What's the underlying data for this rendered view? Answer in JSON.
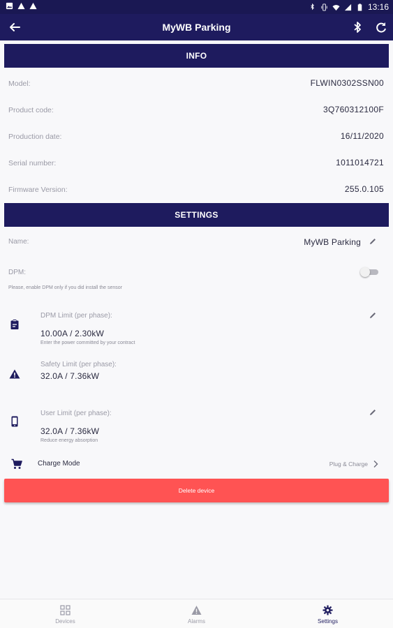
{
  "status_bar": {
    "time": "13:16",
    "left_icons": [
      "image-icon",
      "warning-icon",
      "warning-icon"
    ],
    "right_icons": [
      "bluetooth-icon",
      "vibrate-icon",
      "wifi-icon",
      "signal-icon",
      "battery-icon"
    ]
  },
  "app_bar": {
    "title": "MyWB Parking",
    "icons": [
      "back-arrow-icon",
      "bluetooth-icon",
      "refresh-icon"
    ]
  },
  "info": {
    "header": "INFO",
    "rows": [
      {
        "label": "Model:",
        "value": "FLWIN0302SSN00"
      },
      {
        "label": "Product code:",
        "value": "3Q760312100F"
      },
      {
        "label": "Production date:",
        "value": "16/11/2020"
      },
      {
        "label": "Serial number:",
        "value": "1011014721"
      },
      {
        "label": "Firmware Version:",
        "value": "255.0.105"
      }
    ]
  },
  "settings": {
    "header": "SETTINGS",
    "name_label": "Name:",
    "name_value": "MyWB Parking",
    "dpm_label": "DPM:",
    "dpm_hint": "Please, enable DPM only if you did install the sensor",
    "dpm_enabled": false,
    "dpm_limit": {
      "label": "DPM Limit (per phase):",
      "value": "10.00A / 2.30kW",
      "hint": "Enter the power committed by your contract",
      "icon": "clipboard-icon"
    },
    "safety_limit": {
      "label": "Safety Limit (per phase):",
      "value": "32.0A / 7.36kW",
      "icon": "warning-icon"
    },
    "user_limit": {
      "label": "User Limit (per phase):",
      "value": "32.0A / 7.36kW",
      "hint": "Reduce energy absorption",
      "icon": "phone-icon"
    },
    "charge_mode": {
      "label": "Charge Mode",
      "value": "Plug & Charge",
      "icon": "cart-icon"
    },
    "delete_label": "Delete device"
  },
  "bottom_nav": {
    "items": [
      {
        "label": "Devices",
        "icon": "grid-icon",
        "active": false
      },
      {
        "label": "Alarms",
        "icon": "warning-icon",
        "active": false
      },
      {
        "label": "Settings",
        "icon": "gear-icon",
        "active": true
      }
    ]
  },
  "colors": {
    "primary": "#1e1b5e",
    "danger": "#ff5353",
    "muted_text": "#9a9aa6"
  }
}
